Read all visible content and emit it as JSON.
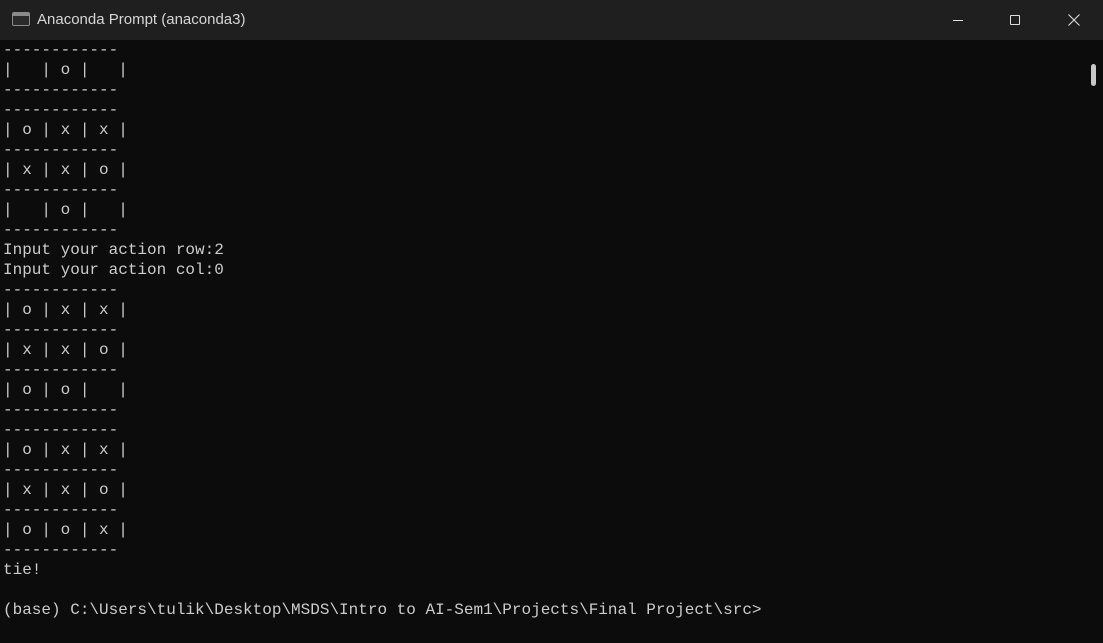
{
  "window": {
    "title": "Anaconda Prompt (anaconda3)",
    "icon": "terminal-icon",
    "controls": {
      "minimize": "minimize-icon",
      "maximize": "maximize-icon",
      "close": "close-icon"
    }
  },
  "console": {
    "lines": [
      "------------",
      "|   | o |   |",
      "------------",
      "------------",
      "| o | x | x |",
      "------------",
      "| x | x | o |",
      "------------",
      "|   | o |   |",
      "------------",
      "Input your action row:2",
      "Input your action col:0",
      "------------",
      "| o | x | x |",
      "------------",
      "| x | x | o |",
      "------------",
      "| o | o |   |",
      "------------",
      "------------",
      "| o | x | x |",
      "------------",
      "| x | x | o |",
      "------------",
      "| o | o | x |",
      "------------",
      "tie!",
      "",
      "(base) C:\\Users\\tulik\\Desktop\\MSDS\\Intro to AI-Sem1\\Projects\\Final Project\\src>"
    ]
  },
  "colors": {
    "background": "#0c0c0c",
    "titlebar": "#1f1f1f",
    "text": "#cccccc"
  }
}
